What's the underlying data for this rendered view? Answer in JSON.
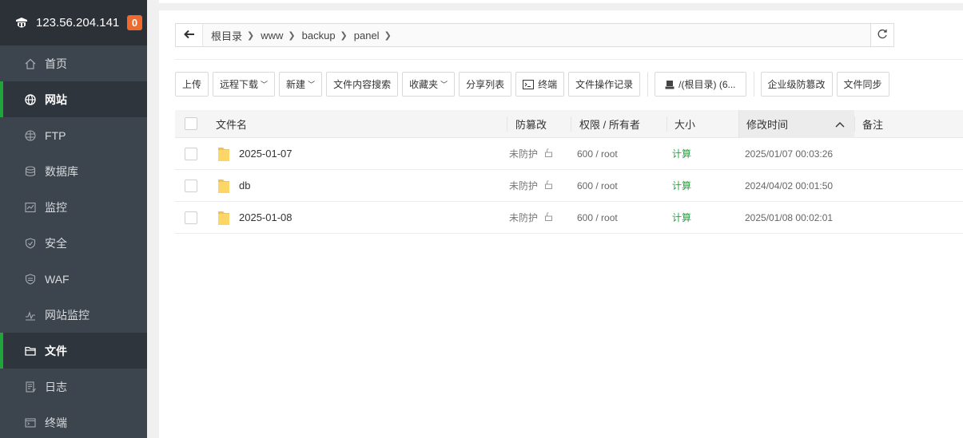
{
  "sidebar": {
    "ip": "123.56.204.141",
    "badge": "0",
    "items": [
      {
        "label": "首页",
        "icon": "home-icon"
      },
      {
        "label": "网站",
        "icon": "globe-icon"
      },
      {
        "label": "FTP",
        "icon": "ftp-icon"
      },
      {
        "label": "数据库",
        "icon": "database-icon"
      },
      {
        "label": "监控",
        "icon": "monitor-icon"
      },
      {
        "label": "安全",
        "icon": "shield-icon"
      },
      {
        "label": "WAF",
        "icon": "waf-icon"
      },
      {
        "label": "网站监控",
        "icon": "site-monitor-icon"
      },
      {
        "label": "文件",
        "icon": "folder-icon"
      },
      {
        "label": "日志",
        "icon": "log-icon"
      },
      {
        "label": "终端",
        "icon": "terminal-icon"
      }
    ]
  },
  "path": {
    "crumbs": [
      "根目录",
      "www",
      "backup",
      "panel"
    ]
  },
  "toolbar": {
    "upload": "上传",
    "remote_download": "远程下载",
    "new": "新建",
    "content_search": "文件内容搜索",
    "favorites": "收藏夹",
    "share_list": "分享列表",
    "terminal": "终端",
    "operation_log": "文件操作记录",
    "disk": "/(根目录) (6...",
    "tamper_proof": "企业级防篡改",
    "sync": "文件同步"
  },
  "table": {
    "headers": {
      "name": "文件名",
      "protect": "防篡改",
      "perm": "权限 / 所有者",
      "size": "大小",
      "mtime": "修改时间",
      "note": "备注"
    },
    "rows": [
      {
        "name": "2025-01-07",
        "protect": "未防护",
        "perm": "600 / root",
        "size": "计算",
        "mtime": "2025/01/07 00:03:26"
      },
      {
        "name": "db",
        "protect": "未防护",
        "perm": "600 / root",
        "size": "计算",
        "mtime": "2024/04/02 00:01:50"
      },
      {
        "name": "2025-01-08",
        "protect": "未防护",
        "perm": "600 / root",
        "size": "计算",
        "mtime": "2025/01/08 00:02:01"
      }
    ]
  }
}
